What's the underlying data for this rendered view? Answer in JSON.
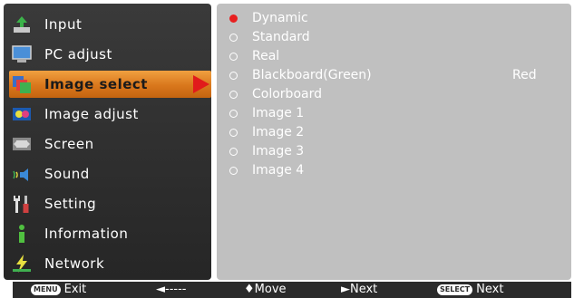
{
  "menu": {
    "items": [
      {
        "label": "Input",
        "icon": "input-icon"
      },
      {
        "label": "PC adjust",
        "icon": "monitor-icon"
      },
      {
        "label": "Image select",
        "icon": "image-select-icon"
      },
      {
        "label": "Image adjust",
        "icon": "image-adjust-icon"
      },
      {
        "label": "Screen",
        "icon": "screen-icon"
      },
      {
        "label": "Sound",
        "icon": "speaker-icon"
      },
      {
        "label": "Setting",
        "icon": "tools-icon"
      },
      {
        "label": "Information",
        "icon": "info-icon"
      },
      {
        "label": "Network",
        "icon": "network-icon"
      }
    ],
    "selected_label": "Image select"
  },
  "options": [
    {
      "label": "Dynamic",
      "selected": true
    },
    {
      "label": "Standard",
      "selected": false
    },
    {
      "label": "Real",
      "selected": false
    },
    {
      "label": "Blackboard(Green)",
      "selected": false
    },
    {
      "label": "Colorboard",
      "selected": false
    },
    {
      "label": "Image 1",
      "selected": false
    },
    {
      "label": "Image 2",
      "selected": false
    },
    {
      "label": "Image 3",
      "selected": false
    },
    {
      "label": "Image 4",
      "selected": false
    }
  ],
  "colorboard_value": "Red",
  "guide": {
    "exit_key": "MENU",
    "exit_label": "Exit",
    "back_label": "◄-----",
    "move_label": "♦Move",
    "next_label": "►Next",
    "select_key": "SELECT",
    "select_next_label": "Next"
  },
  "colors": {
    "accent": "#d9771c",
    "selected_radio": "#e81f1f",
    "panel_bg": "#c0c0c0",
    "menu_bg": "#2e2e2e"
  }
}
